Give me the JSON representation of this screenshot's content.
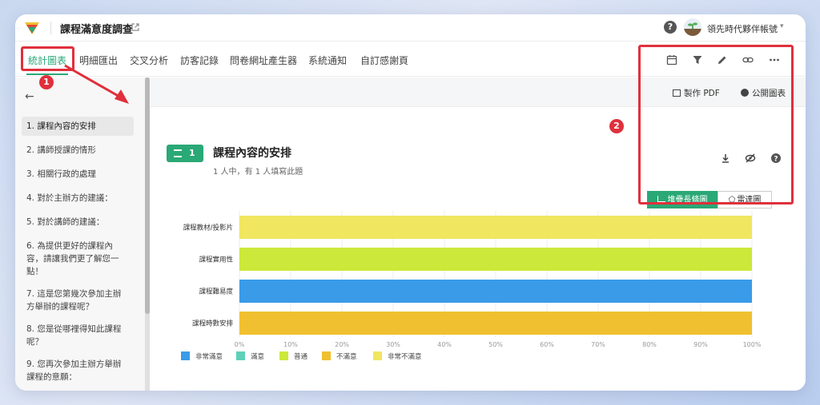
{
  "header": {
    "title": "課程滿意度調查",
    "help_glyph": "?",
    "user_name": "領先時代夥伴帳號",
    "user_caret": "▾"
  },
  "nav": {
    "tabs": [
      {
        "label": "統計圖表",
        "active": true
      },
      {
        "label": "明細匯出"
      },
      {
        "label": "交叉分析"
      },
      {
        "label": "訪客記錄"
      },
      {
        "label": "問卷網址產生器"
      },
      {
        "label": "系統通知"
      },
      {
        "label": "自訂感謝頁"
      }
    ],
    "toolbar_icons": [
      "calendar-icon",
      "filter-icon",
      "pencil-icon",
      "link-icon",
      "more-icon"
    ]
  },
  "annotations": {
    "badge1": "1",
    "badge2": "2",
    "highlight_color": "#e0303c"
  },
  "sidebar": {
    "back_glyph": "←",
    "items": [
      {
        "label": "1. 課程內容的安排",
        "active": true
      },
      {
        "label": "2. 講師授課的情形"
      },
      {
        "label": "3. 相關行政的處理"
      },
      {
        "label": "4. 對於主辦方的建議："
      },
      {
        "label": "5. 對於講師的建議："
      },
      {
        "label": "6. 為提供更好的課程內容，請讓我們更了解您一點！"
      },
      {
        "label": "7. 這是您第幾次參加主辦方舉辦的課程呢？"
      },
      {
        "label": "8. 您是從哪裡得知此課程呢？"
      },
      {
        "label": "9. 您再次參加主辦方舉辦課程的意願："
      }
    ]
  },
  "main": {
    "actions": {
      "pdf": "製作 PDF",
      "public_chart": "公開圖表"
    },
    "question": {
      "number": "1",
      "title": "課程內容的安排",
      "subtitle": "1 人中，有 1 人填寫此題"
    },
    "chart_type_buttons": {
      "stacked_bar": "堆疊長條圖",
      "radar": "雷達圖"
    }
  },
  "colors": {
    "accent": "#2aa876",
    "非常滿意": "#3a9be8",
    "滿意": "#5ed1b8",
    "普通": "#cce83a",
    "不滿意": "#f0c030",
    "非常不滿意": "#f0e660"
  },
  "chart_data": {
    "type": "bar",
    "orientation": "horizontal",
    "stacked": true,
    "categories": [
      "課程教材/投影片",
      "課程實用性",
      "課程難易度",
      "課程時數安排"
    ],
    "series": [
      {
        "name": "非常滿意",
        "values": [
          0,
          0,
          100,
          0
        ]
      },
      {
        "name": "滿意",
        "values": [
          0,
          0,
          0,
          0
        ]
      },
      {
        "name": "普通",
        "values": [
          0,
          100,
          0,
          0
        ]
      },
      {
        "name": "不滿意",
        "values": [
          0,
          0,
          0,
          100
        ]
      },
      {
        "name": "非常不滿意",
        "values": [
          100,
          0,
          0,
          0
        ]
      }
    ],
    "xlim": [
      0,
      100
    ],
    "xticks": [
      "0%",
      "10%",
      "20%",
      "30%",
      "40%",
      "50%",
      "60%",
      "70%",
      "80%",
      "90%",
      "100%"
    ],
    "legend_position": "bottom"
  }
}
